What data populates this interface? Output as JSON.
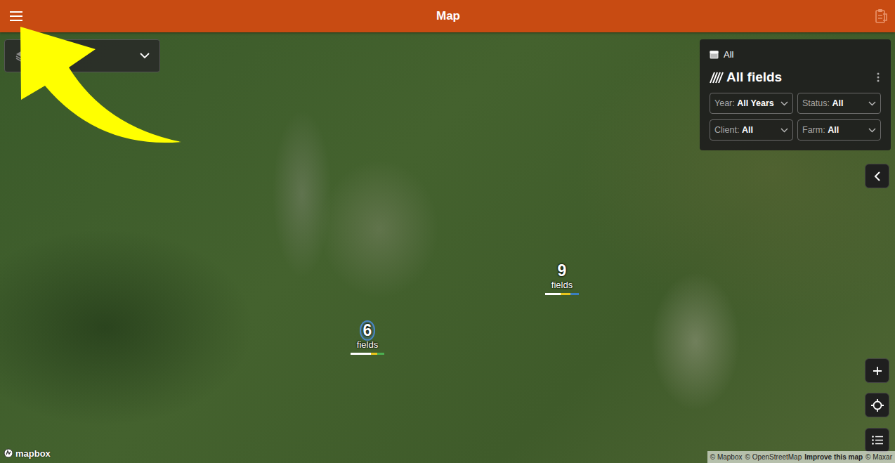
{
  "header": {
    "title": "Map"
  },
  "panel": {
    "date_filter": "All",
    "title": "All fields",
    "filters": [
      {
        "key": "Year:",
        "value": "All Years"
      },
      {
        "key": "Status:",
        "value": "All"
      },
      {
        "key": "Client:",
        "value": "All"
      },
      {
        "key": "Farm:",
        "value": "All"
      }
    ]
  },
  "clusters": [
    {
      "count": "9",
      "label": "fields",
      "highlighted": false,
      "segments": [
        {
          "color": "#ffffff",
          "level": 0.45
        },
        {
          "color": "#e8c51c",
          "level": 0.3
        },
        {
          "color": "#3a7fc1",
          "level": 0.25
        }
      ]
    },
    {
      "count": "6",
      "label": "fields",
      "highlighted": true,
      "segments": [
        {
          "color": "#ffffff",
          "level": 0.6
        },
        {
          "color": "#e8c51c",
          "level": 0.2
        },
        {
          "color": "#4caf50",
          "level": 0.2
        }
      ]
    }
  ],
  "logo": "mapbox",
  "attribution": [
    {
      "text": "© Mapbox",
      "bold": false
    },
    {
      "text": "© OpenStreetMap",
      "bold": false
    },
    {
      "text": "Improve this map",
      "bold": true
    },
    {
      "text": "© Maxar",
      "bold": false
    }
  ]
}
